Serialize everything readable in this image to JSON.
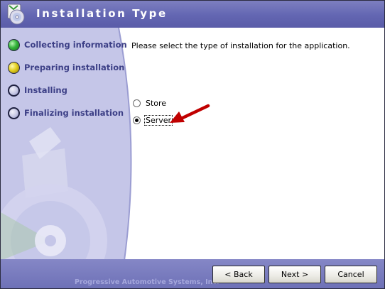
{
  "window": {
    "title": "Installation Type",
    "company": "Progressive Automotive Systems, Inc."
  },
  "steps": [
    {
      "label": "Collecting information",
      "status": "complete",
      "icon": "green-bullet-icon"
    },
    {
      "label": "Preparing installation",
      "status": "current",
      "icon": "yellow-bullet-icon"
    },
    {
      "label": "Installing",
      "status": "pending",
      "icon": "empty-bullet-icon"
    },
    {
      "label": "Finalizing installation",
      "status": "pending",
      "icon": "empty-bullet-icon"
    }
  ],
  "content": {
    "prompt": "Please select the type of installation for the application.",
    "options": [
      {
        "label": "Store",
        "selected": false
      },
      {
        "label": "Server",
        "selected": true
      }
    ]
  },
  "buttons": {
    "back": "< Back",
    "next": "Next >",
    "cancel": "Cancel"
  },
  "colors": {
    "titlebar": "#6366b2",
    "sidebar": "#c8c9ea",
    "step_text": "#3c3f86",
    "annotation_arrow": "#c00000"
  }
}
